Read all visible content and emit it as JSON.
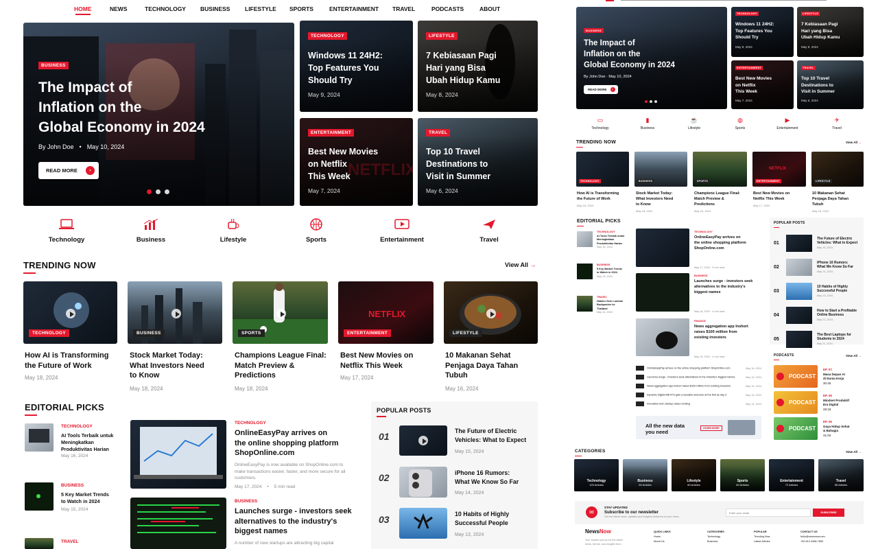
{
  "nav": [
    "HOME",
    "NEWS",
    "TECHNOLOGY",
    "BUSINESS",
    "LIFESTYLE",
    "SPORTS",
    "ENTERTAINMENT",
    "TRAVEL",
    "PODCASTS",
    "ABOUT"
  ],
  "hero": {
    "tag": "BUSINESS",
    "title_l1": "The Impact of",
    "title_l2": "Inflation on the",
    "title_l3": "Global Economy in 2024",
    "author": "By John Doe",
    "date": "May 10, 2024",
    "button": "READ MORE"
  },
  "side_cards": [
    {
      "tag": "TECHNOLOGY",
      "l1": "Windows 11 24H2:",
      "l2": "Top Features You",
      "l3": "Should Try",
      "date": "May 9, 2024"
    },
    {
      "tag": "LIFESTYLE",
      "l1": "7 Kebiasaan Pagi",
      "l2": "Hari yang Bisa",
      "l3": "Ubah Hidup Kamu",
      "date": "May 8, 2024"
    },
    {
      "tag": "ENTERTAINMENT",
      "l1": "Best New Movies",
      "l2": "on Netflix",
      "l3": "This Week",
      "date": "May 7, 2024"
    },
    {
      "tag": "TRAVEL",
      "l1": "Top 10 Travel",
      "l2": "Destinations to",
      "l3": "Visit in Summer",
      "date": "May 6, 2024"
    }
  ],
  "categories": [
    "Technology",
    "Business",
    "Lifestyle",
    "Sports",
    "Entertainment",
    "Travel"
  ],
  "trending": {
    "title": "TRENDING NOW",
    "view_all": "View All",
    "items": [
      {
        "tag": "TECHNOLOGY",
        "l1": "How AI is Transforming",
        "l2": "the Future of Work",
        "l3": "",
        "date": "May 18, 2024"
      },
      {
        "tag": "BUSINESS",
        "l1": "Stock Market Today:",
        "l2": "What Investors Need",
        "l3": "to Know",
        "date": "May 18, 2024"
      },
      {
        "tag": "SPORTS",
        "l1": "Champions League Final:",
        "l2": "Match Preview &",
        "l3": "Predictions",
        "date": "May 18, 2024"
      },
      {
        "tag": "ENTERTAINMENT",
        "l1": "Best New Movies on",
        "l2": "Netflix This Week",
        "l3": "",
        "date": "May 17, 2024"
      },
      {
        "tag": "LIFESTYLE",
        "l1": "10 Makanan Sehat",
        "l2": "Penjaga Daya Tahan",
        "l3": "Tubuh",
        "date": "May 16, 2024"
      }
    ]
  },
  "editorial": {
    "title": "EDITORIAL PICKS",
    "small": [
      {
        "tag": "TECHNOLOGY",
        "l1": "AI Tools Terbaik untuk",
        "l2": "Meningkatkan",
        "l3": "Produktivitas Harian",
        "date": "May 16, 2024"
      },
      {
        "tag": "BUSINESS",
        "l1": "5 Key Market Trends",
        "l2": "to Watch in 2024",
        "l3": "",
        "date": "May 15, 2024"
      },
      {
        "tag": "TRAVEL",
        "l1": "",
        "l2": "",
        "l3": "",
        "date": ""
      }
    ],
    "main": [
      {
        "tag": "TECHNOLOGY",
        "l1": "OnlineEasyPay arrives on",
        "l2": "the online shopping platform",
        "l3": "ShopOnline.com",
        "ex1": "OnlineEasyPay is now available on ShopOnline.com to",
        "ex2": "make transactions easier, faster, and more secure for all",
        "ex3": "customers.",
        "date": "May 17, 2024",
        "read": "5 min read"
      },
      {
        "tag": "BUSINESS",
        "l1": "Launches surge - investors seek",
        "l2": "alternatives to the industry's",
        "l3": "biggest names",
        "ex1": "A number of new startups are attracting big capital",
        "ex2": "",
        "ex3": "",
        "date": "",
        "read": ""
      }
    ]
  },
  "popular": {
    "title": "POPULAR POSTS",
    "items": [
      {
        "num": "01",
        "l1": "The Future of Electric",
        "l2": "Vehicles: What to Expect",
        "date": "May 15, 2024"
      },
      {
        "num": "02",
        "l1": "iPhone 16 Rumors:",
        "l2": "What We Know So Far",
        "date": "May 14, 2024"
      },
      {
        "num": "03",
        "l1": "10 Habits of Highly",
        "l2": "Successful People",
        "date": "May 13, 2024"
      }
    ]
  },
  "right": {
    "hero": {
      "tag": "BUSINESS",
      "l1": "The Impact of",
      "l2": "Inflation on the",
      "l3": "Global Economy in 2024",
      "author": "By John Doe",
      "date": "May 10, 2024",
      "button": "READ MORE"
    },
    "cards": [
      {
        "tag": "TECHNOLOGY",
        "l1": "Windows 11 24H2:",
        "l2": "Top Features You",
        "l3": "Should Try",
        "date": "May 9, 2024"
      },
      {
        "tag": "LIFESTYLE",
        "l1": "7 Kebiasaan Pagi",
        "l2": "Hari yang Bisa",
        "l3": "Ubah Hidup Kamu",
        "date": "May 8, 2024"
      },
      {
        "tag": "ENTERTAINMENT",
        "l1": "Best New Movies",
        "l2": "on Netflix",
        "l3": "This Week",
        "date": "May 7, 2024"
      },
      {
        "tag": "TRAVEL",
        "l1": "Top 10 Travel",
        "l2": "Destinations to",
        "l3": "Visit in Summer",
        "date": "May 6, 2024"
      }
    ],
    "cats": [
      "Technology",
      "Business",
      "Lifestyle",
      "Sports",
      "Entertainment",
      "Travel"
    ],
    "trending_title": "TRENDING NOW",
    "view_all": "View All",
    "trending": [
      {
        "tag": "TECHNOLOGY",
        "l1": "How AI is Transforming",
        "l2": "the Future of Work",
        "l3": "",
        "date": "May 18, 2024"
      },
      {
        "tag": "BUSINESS",
        "l1": "Stock Market Today:",
        "l2": "What Investors Need",
        "l3": "to Know",
        "date": "May 18, 2024"
      },
      {
        "tag": "SPORTS",
        "l1": "Champions League Final:",
        "l2": "Match Preview &",
        "l3": "Predictions",
        "date": "May 18, 2024"
      },
      {
        "tag": "ENTERTAINMENT",
        "l1": "Best New Movies on",
        "l2": "Netflix This Week",
        "l3": "",
        "date": "May 17, 2024"
      },
      {
        "tag": "LIFESTYLE",
        "l1": "10 Makanan Sehat",
        "l2": "Penjaga Daya Tahan",
        "l3": "Tubuh",
        "date": "May 16, 2024"
      }
    ],
    "editorial_title": "EDITORIAL PICKS",
    "ed_small": [
      {
        "tag": "TECHNOLOGY",
        "l1": "AI Tools Terbaik untuk",
        "l2": "Meningkatkan",
        "l3": "Produktivitas Harian",
        "date": "May 16, 2024"
      },
      {
        "tag": "BUSINESS",
        "l1": "5 Key Market Trends",
        "l2": "to Watch in 2024",
        "l3": "",
        "date": "May 15, 2024"
      },
      {
        "tag": "TRAVEL",
        "l1": "Hidden Gem Lombok",
        "l2": "Backpacker ke",
        "l3": "Thailand",
        "date": "May 14, 2024"
      }
    ],
    "ed_main": [
      {
        "tag": "TECHNOLOGY",
        "l1": "OnlineEasyPay arrives on",
        "l2": "the online shopping platform",
        "l3": "ShopOnline.com",
        "date": "May 17, 2024",
        "read": "5 min read"
      },
      {
        "tag": "BUSINESS",
        "l1": "Launches surge - investors seek",
        "l2": "alternatives to the industry's",
        "l3": "biggest names",
        "date": "May 16, 2024",
        "read": "4 min read"
      },
      {
        "tag": "FINANCE",
        "l1": "News aggregation app Inshort",
        "l2": "raises $100 million from",
        "l3": "existing investors",
        "date": "May 15, 2024",
        "read": "4 min read"
      }
    ],
    "ed_list": [
      {
        "t": "OnlineEasyPay arrives on the online shopping platform ShopOnline.com",
        "d": "May 16, 2024"
      },
      {
        "t": "Launches surge - investors seek alternatives to the industry's biggest names",
        "d": "May 16, 2024"
      },
      {
        "t": "News aggregation app Inshort raises $100 million from existing investors",
        "d": "May 15, 2024"
      },
      {
        "t": "Dynamic Digital Mill IPO gets a sizeable welcome at the first as day 3",
        "d": "May 15, 2024"
      },
      {
        "t": "Innovative tech startup raises funding",
        "d": "May 14, 2024"
      }
    ],
    "banner": {
      "l1": "All the new data",
      "l2": "you need",
      "btn": "LEARN MORE"
    },
    "popular_title": "POPULAR POSTS",
    "popular": [
      {
        "num": "01",
        "l1": "The Future of Electric",
        "l2": "Vehicles: What to Expect",
        "date": "May 15, 2024"
      },
      {
        "num": "02",
        "l1": "iPhone 16 Rumors:",
        "l2": "What We Know So Far",
        "date": "May 14, 2024"
      },
      {
        "num": "03",
        "l1": "10 Habits of Highly",
        "l2": "Successful People",
        "date": "May 13, 2024"
      },
      {
        "num": "04",
        "l1": "How to Start a Profitable",
        "l2": "Online Business",
        "date": "May 12, 2024"
      },
      {
        "num": "05",
        "l1": "The Best Laptops for",
        "l2": "Students in 2024",
        "date": "May 11, 2024"
      }
    ],
    "podcasts_title": "PODCASTS",
    "podcasts": [
      {
        "label": "PODCAST",
        "ep": "EP. 07",
        "l1": "Masa Depan AI",
        "l2": "di Dunia Kerja",
        "dur": "30:45"
      },
      {
        "label": "PODCAST",
        "ep": "EP. 06",
        "l1": "Mindset Produktif",
        "l2": "Era Digital",
        "dur": "28:18"
      },
      {
        "label": "PODCAST",
        "ep": "EP. 05",
        "l1": "Gaya Hidup Sehat",
        "l2": "& Bahagia",
        "dur": "31:03"
      }
    ],
    "categories_title": "CATEGORIES",
    "cat_tiles": [
      {
        "name": "Technology",
        "count": "120 Articles"
      },
      {
        "name": "Business",
        "count": "90 Articles"
      },
      {
        "name": "Lifestyle",
        "count": "80 Articles"
      },
      {
        "name": "Sports",
        "count": "60 Articles"
      },
      {
        "name": "Entertainment",
        "count": "72 Articles"
      },
      {
        "name": "Travel",
        "count": "55 Articles"
      }
    ],
    "newsletter": {
      "kicker": "STAY UPDATED",
      "title": "Subscribe to our newsletter",
      "sub": "Get the latest news, updates and insights delivered to your inbox.",
      "placeholder": "Enter your email",
      "btn": "SUBSCRIBE"
    },
    "footer": {
      "logo_a": "News",
      "logo_b": "Now",
      "desc1": "Your trusted source for the latest",
      "desc2": "news, trends, and insights from",
      "col1": "QUICK LINKS",
      "col2": "CATEGORIES",
      "col3": "POPULAR",
      "col4": "CONTACT US",
      "c1a": "Home",
      "c1b": "About Us",
      "c2a": "Technology",
      "c2b": "Business",
      "c3a": "Trending Now",
      "c3b": "Latest Articles",
      "c4a": "hello@newsnow.com",
      "c4b": "+62 812-3456-7890"
    }
  },
  "colors": {
    "accent": "#e3182d"
  }
}
